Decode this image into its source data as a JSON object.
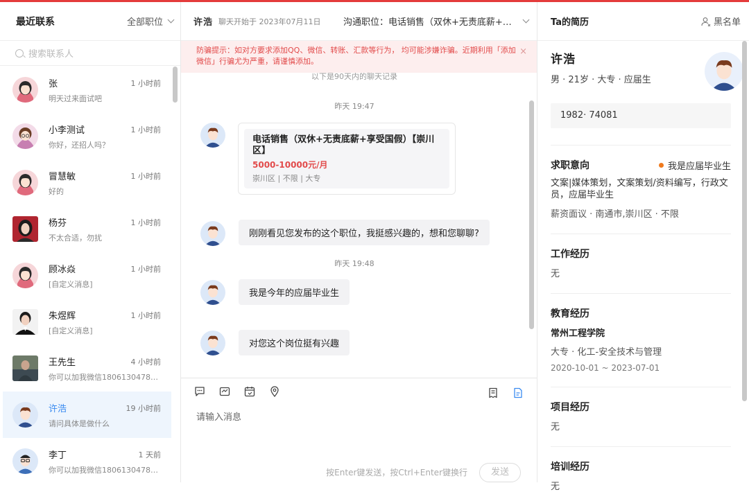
{
  "left": {
    "title": "最近联系",
    "filter": "全部职位",
    "search_placeholder": "搜索联系人",
    "contacts": [
      {
        "name": "张",
        "time": "1 小时前",
        "message": "明天过来面试吧"
      },
      {
        "name": "小李测试",
        "time": "1 小时前",
        "message": "你好，还招人吗？"
      },
      {
        "name": "冒慧敏",
        "time": "1 小时前",
        "message": "好的"
      },
      {
        "name": "杨芬",
        "time": "1 小时前",
        "message": "不太合适，勿扰"
      },
      {
        "name": "顾冰焱",
        "time": "1 小时前",
        "message": "[自定义消息]"
      },
      {
        "name": "朱煜辉",
        "time": "1 小时前",
        "message": "[自定义消息]"
      },
      {
        "name": "王先生",
        "time": "4 小时前",
        "message": "你可以加我微信18061304789..."
      },
      {
        "name": "许浩",
        "time": "19 小时前",
        "message": "请问具体是做什么"
      },
      {
        "name": "李丁",
        "time": "1 天前",
        "message": "你可以加我微信18061304789..."
      }
    ]
  },
  "chat": {
    "header_name": "许浩",
    "started": "聊天开始于 2023年07月11日",
    "position": "沟通职位：电话销售（双休+无责底薪+享…",
    "warning": "防骗提示：如对方要求添加QQ、微信、转账、汇款等行为， 均可能涉嫌诈骗。近期利用「添加微信」行骗尤为严重，请谨慎添加。",
    "history_note": "以下是90天内的聊天记录",
    "time1": "昨天 19:47",
    "job_card": {
      "title": "电话销售（双休+无责底薪+享受国假）【崇川区】",
      "salary": "5000-10000元/月",
      "meta": "崇川区 | 不限 | 大专"
    },
    "msg1": "刚刚看见您发布的这个职位，我挺感兴趣的，想和您聊聊?",
    "time2": "昨天 19:48",
    "msg2": "我是今年的应届毕业生",
    "msg3": "对您这个岗位挺有兴趣",
    "input_placeholder": "请输入消息",
    "hint": "按Enter键发送，按Ctrl+Enter键换行",
    "send": "发送"
  },
  "resume": {
    "title": "Ta的简历",
    "blacklist": "黑名单",
    "name": "许浩",
    "basic": "男 · 21岁 · 大专 · 应届生",
    "phone": "1982·  74081",
    "intent_title": "求职意向",
    "intent_status": "我是应届毕业生",
    "intent_jobs": "文案|媒体策划，文案策划/资料编写，行政文员，应届毕业生",
    "intent_detail": "薪资面议 · 南通市,崇川区 · 不限",
    "work_title": "工作经历",
    "work_value": "无",
    "edu_title": "教育经历",
    "edu_school": "常州工程学院",
    "edu_major": "大专 · 化工-安全技术与管理",
    "edu_date": "2020-10-01 ~ 2023-07-01",
    "project_title": "项目经历",
    "project_value": "无",
    "training_title": "培训经历",
    "training_value": "无"
  },
  "colors": {
    "accent": "#3a8bf0",
    "warning": "#e24b4b",
    "topline": "#e43b3b",
    "status_dot": "#f07a1e"
  }
}
